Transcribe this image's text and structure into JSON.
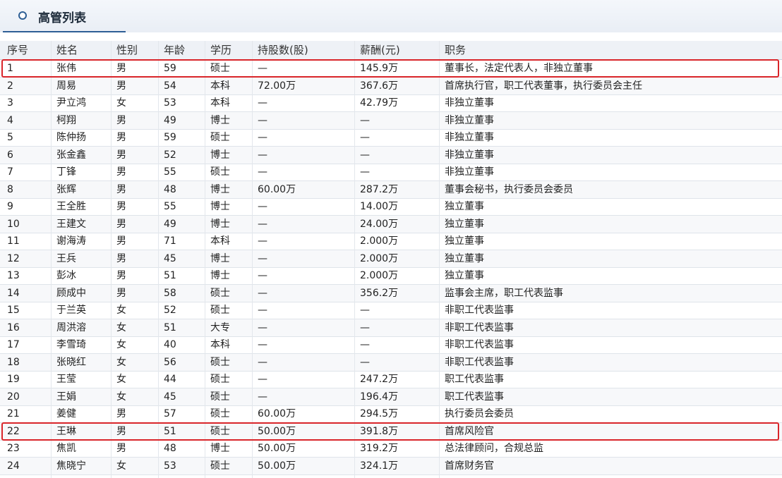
{
  "panel": {
    "title": "高管列表"
  },
  "table": {
    "columns": [
      "序号",
      "姓名",
      "性别",
      "年龄",
      "学历",
      "持股数(股)",
      "薪酬(元)",
      "职务"
    ],
    "rows": [
      [
        "1",
        "张伟",
        "男",
        "59",
        "硕士",
        "—",
        "145.9万",
        "董事长，法定代表人，非独立董事"
      ],
      [
        "2",
        "周易",
        "男",
        "54",
        "本科",
        "72.00万",
        "367.6万",
        "首席执行官，职工代表董事，执行委员会主任"
      ],
      [
        "3",
        "尹立鸿",
        "女",
        "53",
        "本科",
        "—",
        "42.79万",
        "非独立董事"
      ],
      [
        "4",
        "柯翔",
        "男",
        "49",
        "博士",
        "—",
        "—",
        "非独立董事"
      ],
      [
        "5",
        "陈仲扬",
        "男",
        "59",
        "硕士",
        "—",
        "—",
        "非独立董事"
      ],
      [
        "6",
        "张金鑫",
        "男",
        "52",
        "博士",
        "—",
        "—",
        "非独立董事"
      ],
      [
        "7",
        "丁锋",
        "男",
        "55",
        "硕士",
        "—",
        "—",
        "非独立董事"
      ],
      [
        "8",
        "张辉",
        "男",
        "48",
        "博士",
        "60.00万",
        "287.2万",
        "董事会秘书，执行委员会委员"
      ],
      [
        "9",
        "王全胜",
        "男",
        "55",
        "博士",
        "—",
        "14.00万",
        "独立董事"
      ],
      [
        "10",
        "王建文",
        "男",
        "49",
        "博士",
        "—",
        "24.00万",
        "独立董事"
      ],
      [
        "11",
        "谢海涛",
        "男",
        "71",
        "本科",
        "—",
        "2.000万",
        "独立董事"
      ],
      [
        "12",
        "王兵",
        "男",
        "45",
        "博士",
        "—",
        "2.000万",
        "独立董事"
      ],
      [
        "13",
        "彭冰",
        "男",
        "51",
        "博士",
        "—",
        "2.000万",
        "独立董事"
      ],
      [
        "14",
        "顾成中",
        "男",
        "58",
        "硕士",
        "—",
        "356.2万",
        "监事会主席，职工代表监事"
      ],
      [
        "15",
        "于兰英",
        "女",
        "52",
        "硕士",
        "—",
        "—",
        "非职工代表监事"
      ],
      [
        "16",
        "周洪溶",
        "女",
        "51",
        "大专",
        "—",
        "—",
        "非职工代表监事"
      ],
      [
        "17",
        "李雪琦",
        "女",
        "40",
        "本科",
        "—",
        "—",
        "非职工代表监事"
      ],
      [
        "18",
        "张晓红",
        "女",
        "56",
        "硕士",
        "—",
        "—",
        "非职工代表监事"
      ],
      [
        "19",
        "王莹",
        "女",
        "44",
        "硕士",
        "—",
        "247.2万",
        "职工代表监事"
      ],
      [
        "20",
        "王娟",
        "女",
        "45",
        "硕士",
        "—",
        "196.4万",
        "职工代表监事"
      ],
      [
        "21",
        "姜健",
        "男",
        "57",
        "硕士",
        "60.00万",
        "294.5万",
        "执行委员会委员"
      ],
      [
        "22",
        "王琳",
        "男",
        "51",
        "硕士",
        "50.00万",
        "391.8万",
        "首席风险官"
      ],
      [
        "23",
        "焦凯",
        "男",
        "48",
        "博士",
        "50.00万",
        "319.2万",
        "总法律顾问，合规总监"
      ],
      [
        "24",
        "焦晓宁",
        "女",
        "53",
        "硕士",
        "50.00万",
        "324.1万",
        "首席财务官"
      ]
    ]
  },
  "highlighted_rows": [
    "1",
    "22"
  ],
  "colors": {
    "accent": "#2e5f95",
    "highlight_border": "#d9252a",
    "header_bg": "#eef1f6"
  }
}
